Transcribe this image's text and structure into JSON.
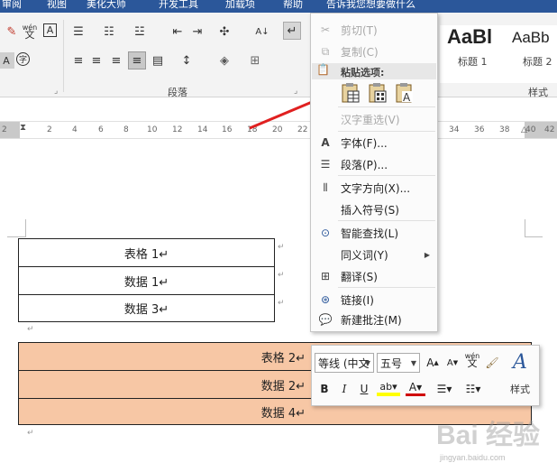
{
  "titlebar": {
    "tabs": [
      "审阅",
      "视图",
      "美化大师",
      "开发工具",
      "加载项",
      "帮助"
    ],
    "tell_me": "告诉我您想要做什么"
  },
  "ribbon": {
    "paragraph_group_label": "段落",
    "styles_group_label": "样式",
    "phonetic_label": "wén",
    "styles": [
      {
        "sample": "AaBl",
        "name": "标题 1"
      },
      {
        "sample": "AaBb",
        "name": "标题 2"
      }
    ]
  },
  "ruler": {
    "numbers": [
      "2",
      "2",
      "4",
      "6",
      "8",
      "10",
      "12",
      "14",
      "16",
      "18",
      "20",
      "22",
      "34",
      "36",
      "38",
      "40",
      "42"
    ]
  },
  "document": {
    "table1": [
      "表格 1↵",
      "数据 1↵",
      "数据 3↵"
    ],
    "table2": [
      "表格 2↵",
      "数据 2↵",
      "数据 4↵"
    ],
    "pilcrow": "↵"
  },
  "context_menu": {
    "cut": "剪切(T)",
    "copy": "复制(C)",
    "paste_options_header": "粘贴选项:",
    "hanzi_reselect": "汉字重选(V)",
    "font": "字体(F)...",
    "paragraph": "段落(P)...",
    "text_direction": "文字方向(X)...",
    "insert_symbol": "插入符号(S)",
    "smart_lookup": "智能查找(L)",
    "synonyms": "同义词(Y)",
    "translate": "翻译(S)",
    "link": "链接(I)",
    "new_comment": "新建批注(M)"
  },
  "mini_toolbar": {
    "font_name": "等线 (中文",
    "font_size": "五号",
    "bold": "B",
    "italic": "I",
    "underline": "U",
    "styles_label": "样式",
    "phonetic_label": "wén"
  },
  "watermark": {
    "brand": "Bai 经验",
    "url": "jingyan.baidu.com"
  },
  "colors": {
    "ribbon_blue": "#2b579a",
    "table2_fill": "#f7c7a5",
    "arrow_red": "#e02020",
    "highlight_yellow": "#ffff00",
    "font_color_red": "#d00000"
  }
}
